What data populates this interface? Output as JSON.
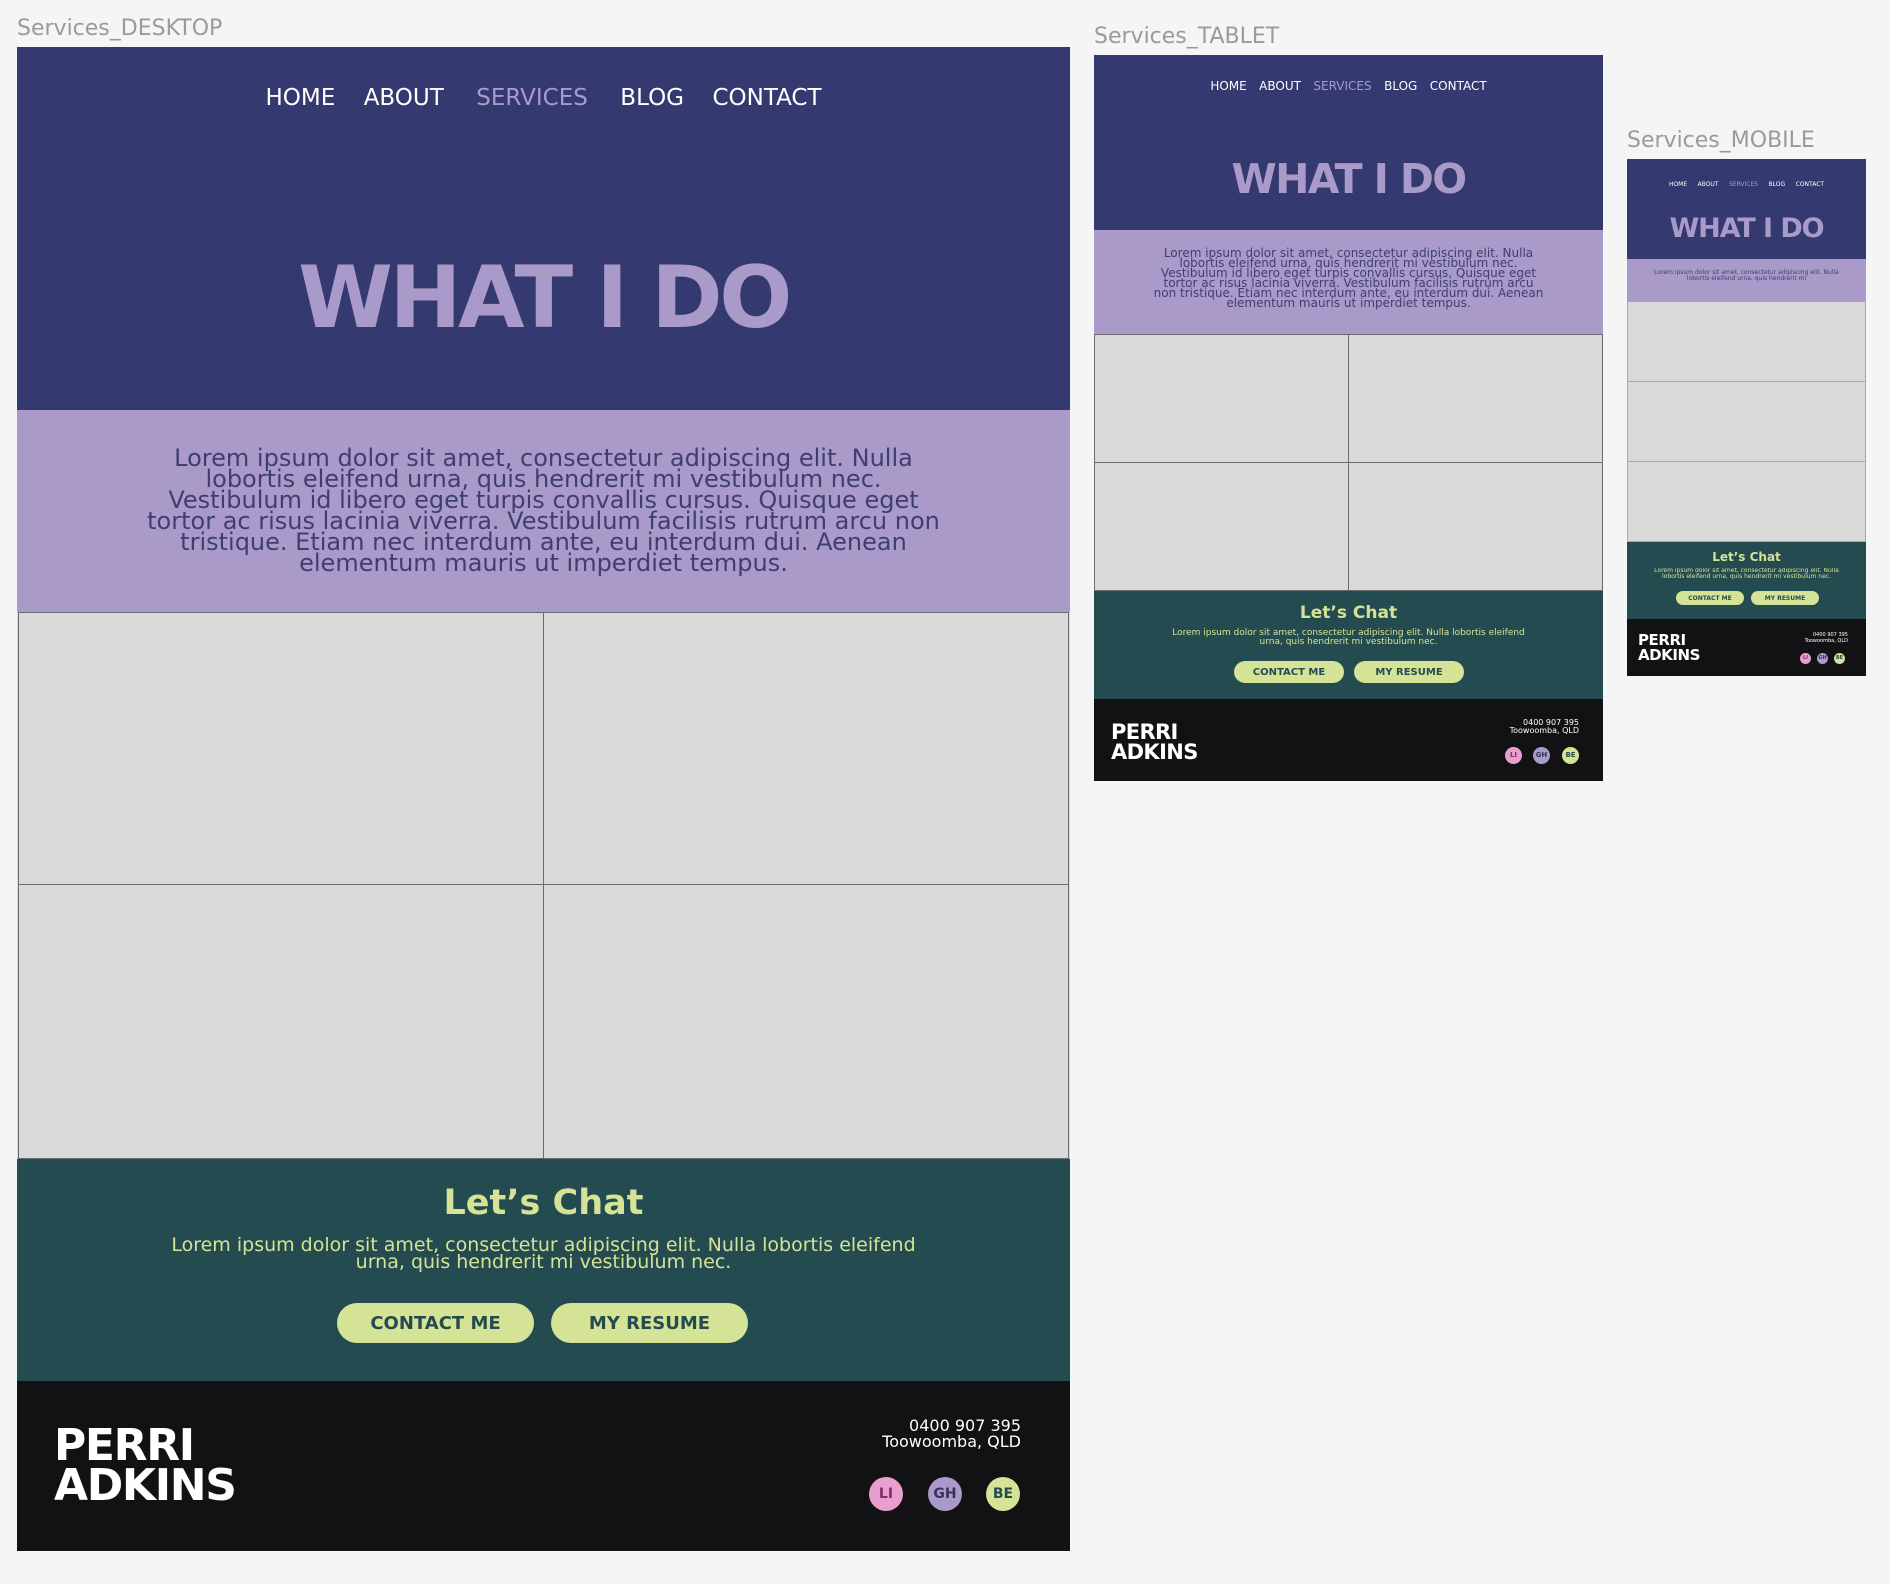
{
  "frames": {
    "desktop_label": "Services_DESKTOP",
    "tablet_label": "Services_TABLET",
    "mobile_label": "Services_MOBILE"
  },
  "nav": {
    "home": "HOME",
    "about": "ABOUT",
    "services": "SERVICES",
    "blog": "BLOG",
    "contact": "CONTACT",
    "active": "SERVICES"
  },
  "hero": {
    "title": "WHAT I DO"
  },
  "intro": {
    "text": "Lorem ipsum dolor sit amet, consectetur adipiscing elit. Nulla lobortis eleifend urna, quis hendrerit mi vestibulum nec. Vestibulum id libero eget turpis convallis cursus. Quisque eget tortor ac risus lacinia viverra. Vestibulum facilisis rutrum arcu non tristique. Etiam nec interdum ante, eu interdum dui. Aenean elementum mauris ut imperdiet tempus.",
    "mobile_text": "Lorem ipsum dolor sit amet, consectetur adipiscing elit. Nulla lobortis eleifend urna, quis hendrerit mi"
  },
  "chat": {
    "title": "Let’s Chat",
    "text": "Lorem ipsum dolor sit amet, consectetur adipiscing elit. Nulla lobortis eleifend urna, quis hendrerit mi vestibulum nec.",
    "contact_button": "CONTACT ME",
    "resume_button": "MY RESUME"
  },
  "footer": {
    "brand_line1": "PERRI",
    "brand_line2": "ADKINS",
    "phone": "0400 907 395",
    "location": "Toowoomba, QLD",
    "social": [
      {
        "label": "LI",
        "icon": "linkedin-icon"
      },
      {
        "label": "GH",
        "icon": "github-icon"
      },
      {
        "label": "BE",
        "icon": "behance-icon"
      }
    ]
  },
  "colors": {
    "navy": "#343a6f",
    "lavender": "#a99ac9",
    "teal": "#244c50",
    "lime": "#d4e395",
    "black": "#121214",
    "placeholder": "#d9d9d9"
  }
}
